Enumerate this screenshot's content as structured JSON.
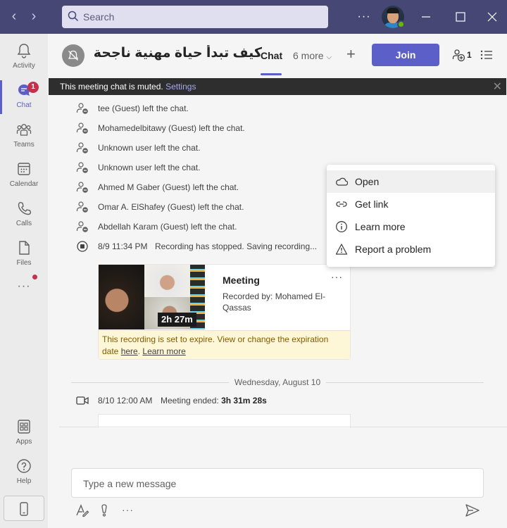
{
  "search": {
    "placeholder": "Search"
  },
  "titlebar": {
    "more_label": "···"
  },
  "rail": {
    "activity": "Activity",
    "chat": "Chat",
    "chat_badge": "1",
    "teams": "Teams",
    "calendar": "Calendar",
    "calls": "Calls",
    "files": "Files",
    "more": "···",
    "apps": "Apps",
    "help": "Help"
  },
  "header": {
    "title": "كيف تبدأ حياة مهنية ناجحة...",
    "tab_chat": "Chat",
    "tab_more": "6 more",
    "join": "Join",
    "participant_count": "1"
  },
  "banner": {
    "text": "This meeting chat is muted.",
    "link": "Settings"
  },
  "messages": [
    "tee (Guest) left the chat.",
    "Mohamedelbitawy (Guest) left the chat.",
    "Unknown user left the chat.",
    "Unknown user left the chat.",
    "Ahmed M Gaber (Guest) left the chat.",
    "Omar A. ElShafey (Guest) left the chat.",
    "Abdellah Karam (Guest) left the chat."
  ],
  "recording_stopped": {
    "time": "8/9 11:34 PM",
    "text": "Recording has stopped. Saving recording..."
  },
  "recording_card": {
    "title": "Meeting",
    "more": "···",
    "recorded_by": "Recorded by: Mohamed El-Qassas",
    "duration": "2h 27m",
    "expire_text": "This recording is set to expire. View or change the expiration date",
    "expire_here": "here",
    "expire_learn": "Learn more"
  },
  "date_divider": "Wednesday, August 10",
  "meeting_ended": {
    "time": "8/10 12:00 AM",
    "label": "Meeting ended:",
    "duration": "3h 31m 28s"
  },
  "context_menu": [
    {
      "label": "Open",
      "icon": "onedrive-icon"
    },
    {
      "label": "Get link",
      "icon": "link-icon"
    },
    {
      "label": "Learn more",
      "icon": "info-icon"
    },
    {
      "label": "Report a problem",
      "icon": "warning-icon"
    }
  ],
  "compose": {
    "placeholder": "Type a new message"
  },
  "colors": {
    "brand": "#5b5fc7",
    "titlebar": "#464775",
    "badge": "#c4314b",
    "presence": "#6bb700"
  }
}
